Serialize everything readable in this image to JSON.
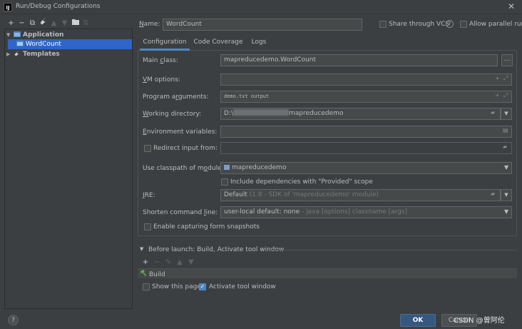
{
  "window": {
    "title": "Run/Debug Configurations",
    "app_icon": "IJ"
  },
  "toolbar": {
    "add": "+",
    "remove": "−",
    "copy": "⧉",
    "settings": "🔧",
    "up": "▲",
    "down": "▼",
    "folder": "▰",
    "sort": "⇅"
  },
  "tree": {
    "items": [
      {
        "label": "Application",
        "level": 0,
        "expanded": true
      },
      {
        "label": "WordCount",
        "level": 1,
        "selected": true
      },
      {
        "label": "Templates",
        "level": 0,
        "expanded": false
      }
    ]
  },
  "header": {
    "name_label": "Name:",
    "name_value": "WordCount",
    "share_vcs_label": "Share through VCS",
    "share_vcs_help": "?",
    "allow_parallel_label": "Allow parallel run"
  },
  "tabs": [
    {
      "label": "Configuration",
      "active": true
    },
    {
      "label": "Code Coverage",
      "active": false
    },
    {
      "label": "Logs",
      "active": false
    }
  ],
  "form": {
    "main_class": {
      "label": "Main class:",
      "value": "mapreducedemo.WordCount"
    },
    "vm_options": {
      "label": "VM options:",
      "value": ""
    },
    "program_arguments": {
      "label": "Program arguments:",
      "value": "demo.txt output"
    },
    "working_directory": {
      "label": "Working directory:",
      "value_prefix": "D:\\",
      "value_suffix": "mapreducedemo"
    },
    "environment_variables": {
      "label": "Environment variables:",
      "value": ""
    },
    "redirect_input": {
      "label": "Redirect input from:",
      "value": "",
      "checked": false
    },
    "classpath_module": {
      "label": "Use classpath of module:",
      "value": "mapreducedemo"
    },
    "include_provided": {
      "label": "Include dependencies with \"Provided\" scope",
      "checked": false
    },
    "jre": {
      "label": "JRE:",
      "value": "Default",
      "hint": "(1.8 - SDK of 'mapreducedemo' module)"
    },
    "shorten_command_line": {
      "label": "Shorten command line:",
      "value": "user-local default: none",
      "hint": "- java [options] classname [args]"
    },
    "capture_snapshots": {
      "label": "Enable capturing form snapshots",
      "checked": false
    }
  },
  "before_launch": {
    "title": "Before launch: Build, Activate tool window",
    "tools": {
      "add": "+",
      "remove": "−",
      "edit": "✎",
      "up": "▲",
      "down": "▼"
    },
    "tasks": [
      {
        "label": "Build"
      }
    ],
    "show_page_label": "Show this page",
    "show_page_checked": false,
    "activate_tool_label": "Activate tool window",
    "activate_tool_checked": true
  },
  "footer": {
    "help": "?",
    "ok": "OK",
    "cancel": "Cancel"
  },
  "watermark": "CSDN @曾阿伦"
}
